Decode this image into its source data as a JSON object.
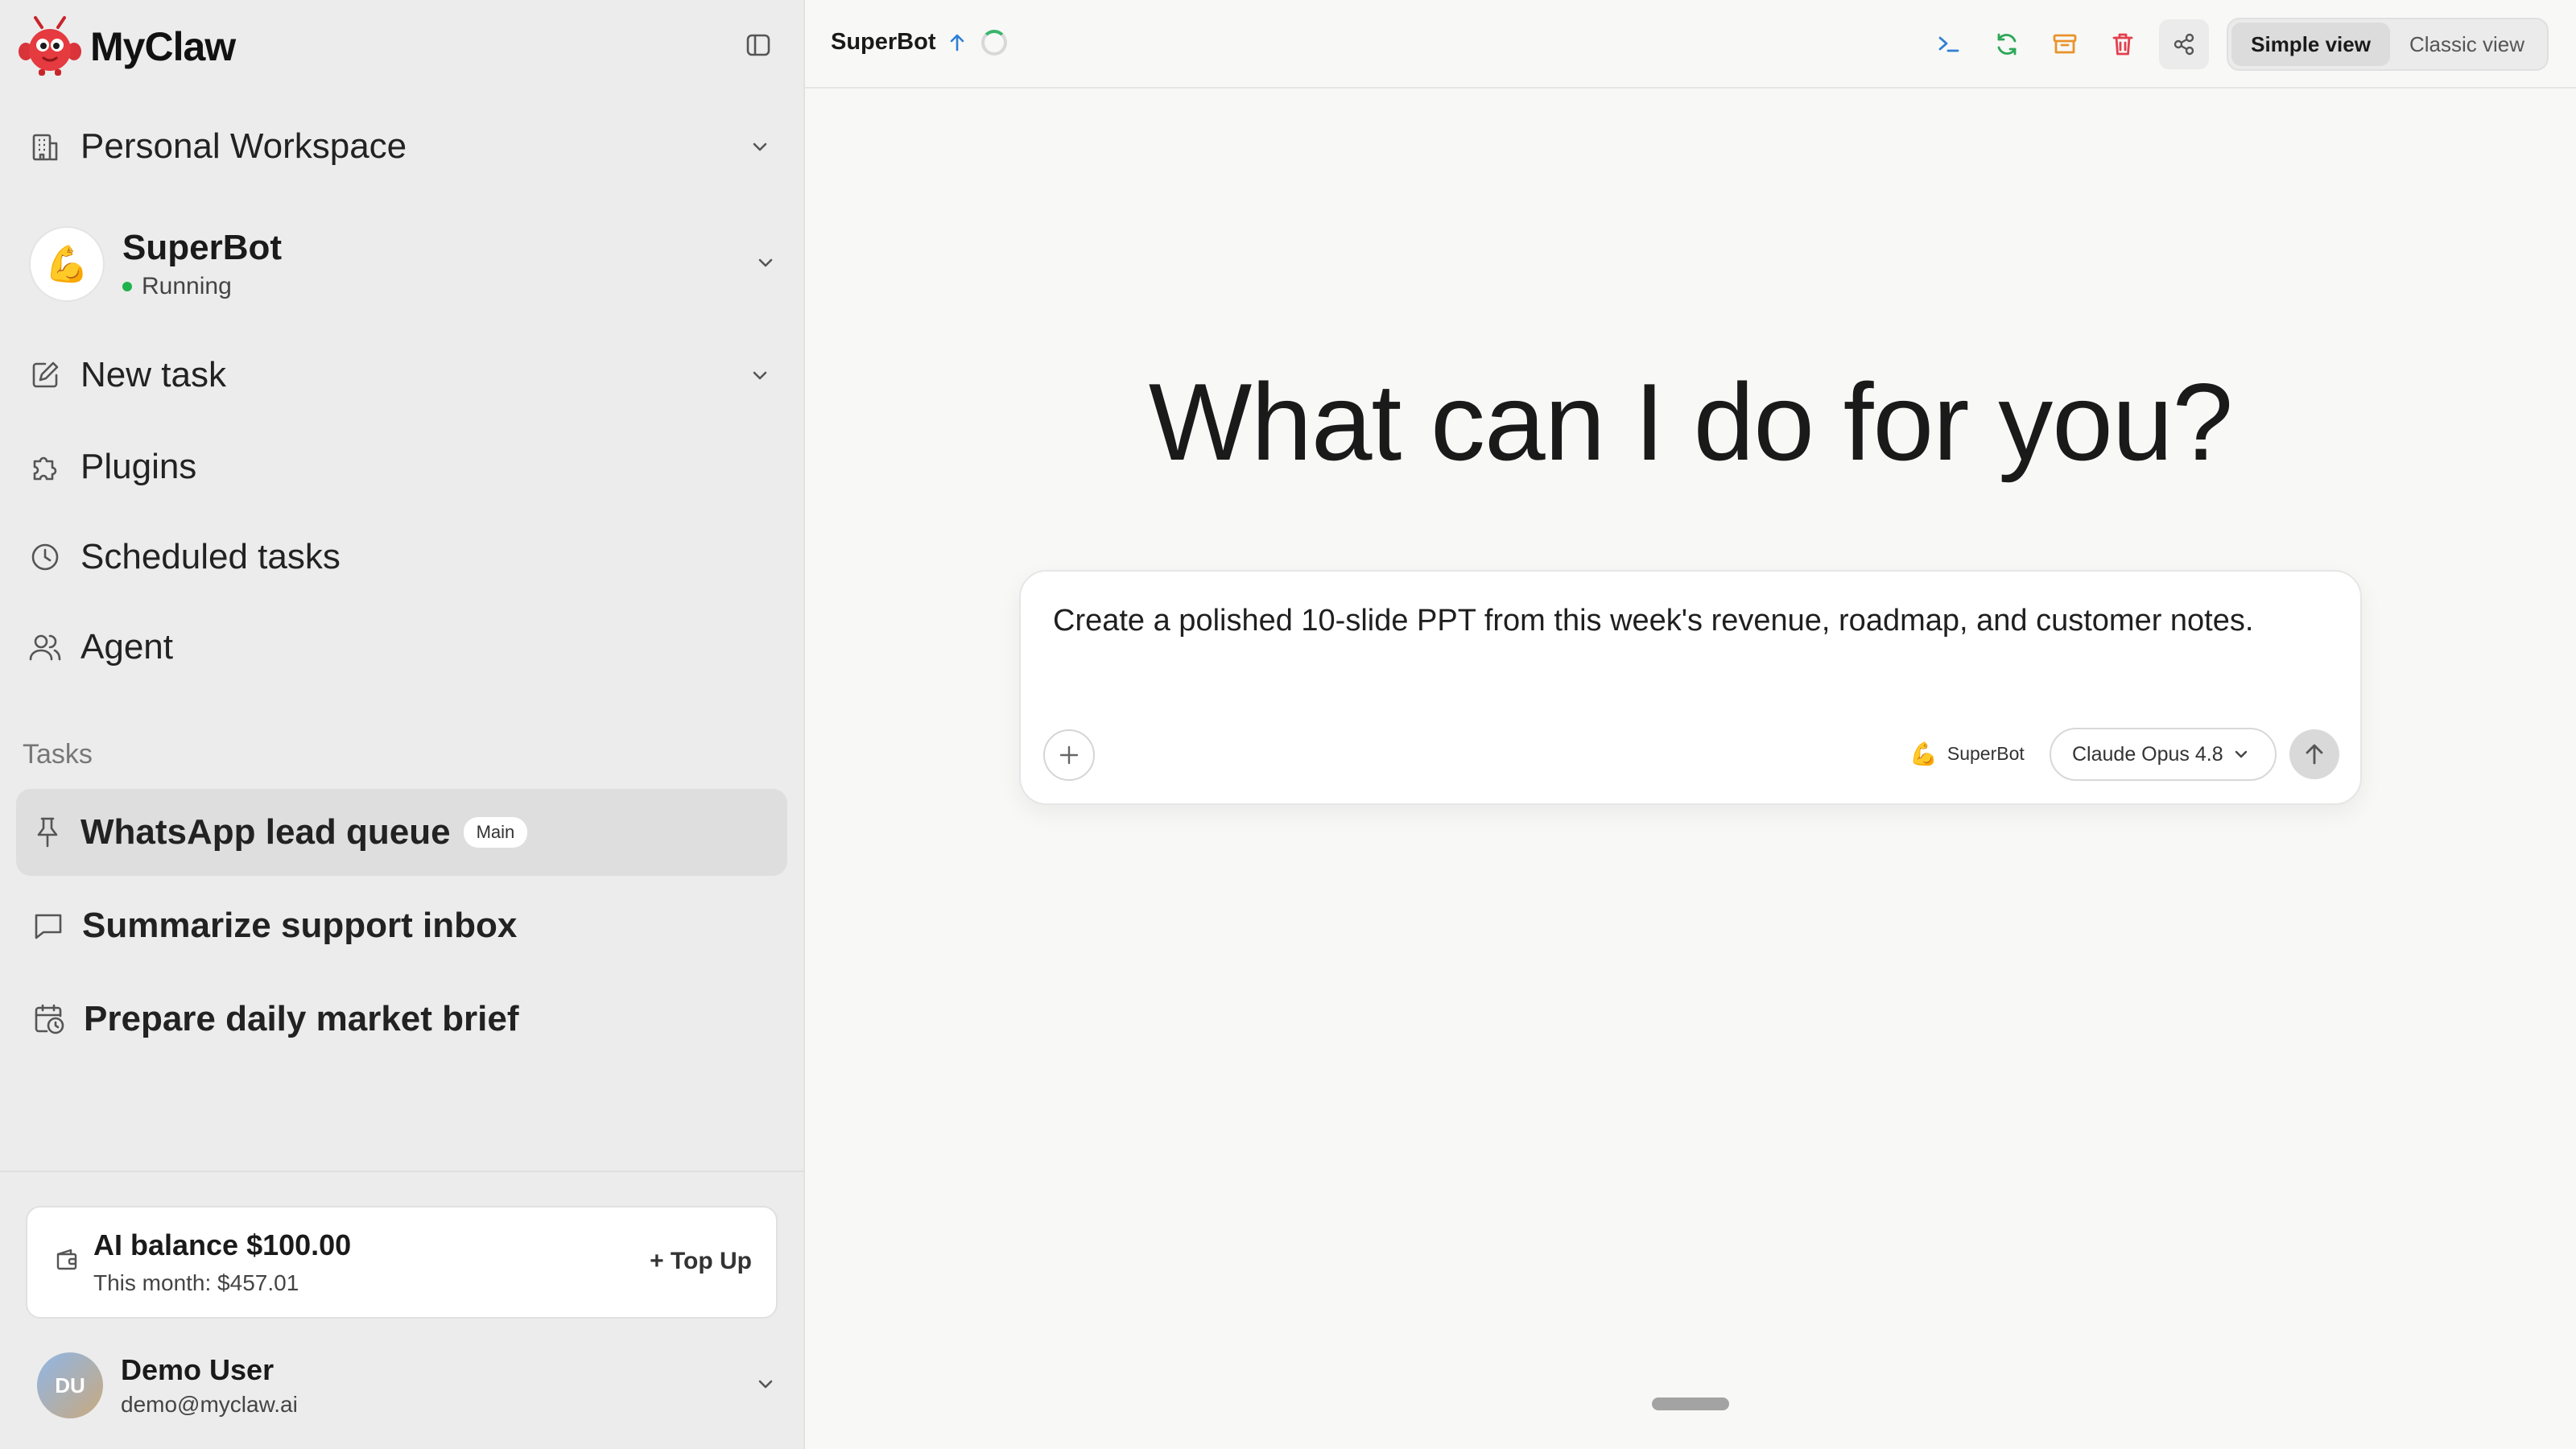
{
  "app": {
    "name": "MyClaw"
  },
  "sidebar": {
    "workspace": "Personal Workspace",
    "bot": {
      "name": "SuperBot",
      "status": "Running",
      "avatar_emoji": "💪"
    },
    "nav": [
      {
        "label": "New task",
        "icon": "edit-icon"
      },
      {
        "label": "Plugins",
        "icon": "puzzle-icon"
      },
      {
        "label": "Scheduled tasks",
        "icon": "clock-icon"
      },
      {
        "label": "Agent",
        "icon": "users-icon"
      }
    ],
    "tasks_heading": "Tasks",
    "tasks": [
      {
        "label": "WhatsApp lead queue",
        "badge": "Main",
        "icon": "pin-icon",
        "active": true
      },
      {
        "label": "Summarize support inbox",
        "icon": "chat-icon"
      },
      {
        "label": "Prepare daily market brief",
        "icon": "calendar-clock-icon"
      }
    ],
    "balance": {
      "title": "AI balance $100.00",
      "month": "This month: $457.01",
      "topup": "+ Top Up"
    },
    "user": {
      "initials": "DU",
      "name": "Demo User",
      "email": "demo@myclaw.ai"
    }
  },
  "topbar": {
    "title": "SuperBot",
    "views": [
      "Simple view",
      "Classic view"
    ],
    "selected_view": "Simple view",
    "tool_icons": [
      "terminal-icon",
      "refresh-icon",
      "archive-icon",
      "trash-icon",
      "share-icon"
    ]
  },
  "main": {
    "heading": "What can I do for you?",
    "composer": {
      "value": "Create a polished 10-slide PPT from this week's revenue, roadmap, and customer notes.",
      "agent_emoji": "💪",
      "agent": "SuperBot",
      "model": "Claude Opus 4.8"
    }
  },
  "colors": {
    "running": "#22b24c",
    "terminal": "#2f7fd6",
    "refresh": "#2ea858",
    "archive": "#e8932a",
    "trash": "#e2404e"
  }
}
